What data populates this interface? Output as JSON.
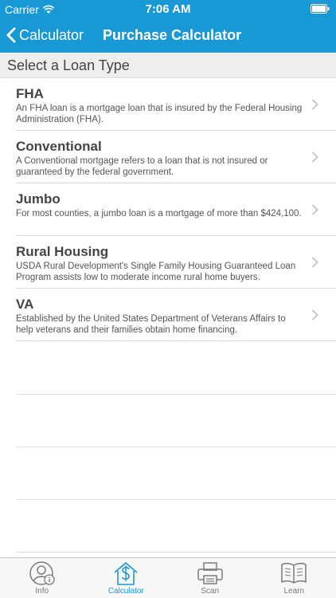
{
  "status_bar": {
    "carrier": "Carrier",
    "time": "7:06 AM"
  },
  "nav": {
    "back_label": "Calculator",
    "title": "Purchase Calculator"
  },
  "section": {
    "title": "Select a Loan Type"
  },
  "loan_types": [
    {
      "title": "FHA",
      "description": "An FHA loan is a mortgage loan that is insured by the Federal Housing Administration (FHA)."
    },
    {
      "title": "Conventional",
      "description": "A Conventional mortgage refers to a loan that is not insured or guaranteed by the federal government."
    },
    {
      "title": "Jumbo",
      "description": "For most counties, a jumbo loan is a mortgage of more than $424,100."
    },
    {
      "title": "Rural Housing",
      "description": "USDA Rural Development's Single Family Housing Guaranteed Loan Program assists low to moderate income rural home buyers."
    },
    {
      "title": "VA",
      "description": "Established by the United States Department of Veterans Affairs to help veterans and their families obtain home financing."
    }
  ],
  "tabs": [
    {
      "label": "Info",
      "icon": "info-person-icon",
      "active": false
    },
    {
      "label": "Calculator",
      "icon": "house-dollar-icon",
      "active": true
    },
    {
      "label": "Scan",
      "icon": "scanner-icon",
      "active": false
    },
    {
      "label": "Learn",
      "icon": "book-icon",
      "active": false
    }
  ],
  "colors": {
    "accent": "#1998d6",
    "tab_inactive": "#777777"
  }
}
